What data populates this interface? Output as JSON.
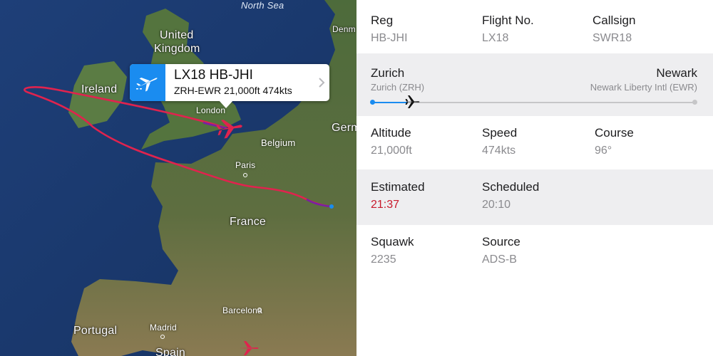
{
  "map": {
    "sea_labels": {
      "north_sea": "North Sea"
    },
    "country_labels": {
      "united_kingdom_line1": "United",
      "united_kingdom_line2": "Kingdom",
      "ireland": "Ireland",
      "belgium": "Belgium",
      "germany_partial": "Germ",
      "denmark_partial": "Denm",
      "france": "France",
      "portugal": "Portugal",
      "spain_partial": "Spain"
    },
    "city_labels": {
      "london": "London",
      "paris": "Paris",
      "barcelona": "Barcelona",
      "madrid": "Madrid"
    },
    "route_color": "#e0234e",
    "flown_color": "#7b1fa2",
    "aircraft_color": "#e0234e",
    "callout": {
      "title": "LX18 HB-JHI",
      "subtitle": "ZRH-EWR 21,000ft 474kts",
      "icon": "airplane-icon",
      "accent": "#1a8cf0"
    }
  },
  "details": {
    "reg": {
      "label": "Reg",
      "value": "HB-JHI"
    },
    "flight_no": {
      "label": "Flight No.",
      "value": "LX18"
    },
    "callsign": {
      "label": "Callsign",
      "value": "SWR18"
    },
    "route": {
      "origin_city": "Zurich",
      "origin_airport": "Zurich (ZRH)",
      "destination_city": "Newark",
      "destination_airport": "Newark Liberty Intl (EWR)",
      "progress": 0.11
    },
    "altitude": {
      "label": "Altitude",
      "value": "21,000ft"
    },
    "speed": {
      "label": "Speed",
      "value": "474kts"
    },
    "course": {
      "label": "Course",
      "value": "96°"
    },
    "estimated": {
      "label": "Estimated",
      "value": "21:37",
      "color": "#c8192b"
    },
    "scheduled": {
      "label": "Scheduled",
      "value": "20:10"
    },
    "squawk": {
      "label": "Squawk",
      "value": "2235"
    },
    "source": {
      "label": "Source",
      "value": "ADS-B"
    }
  }
}
